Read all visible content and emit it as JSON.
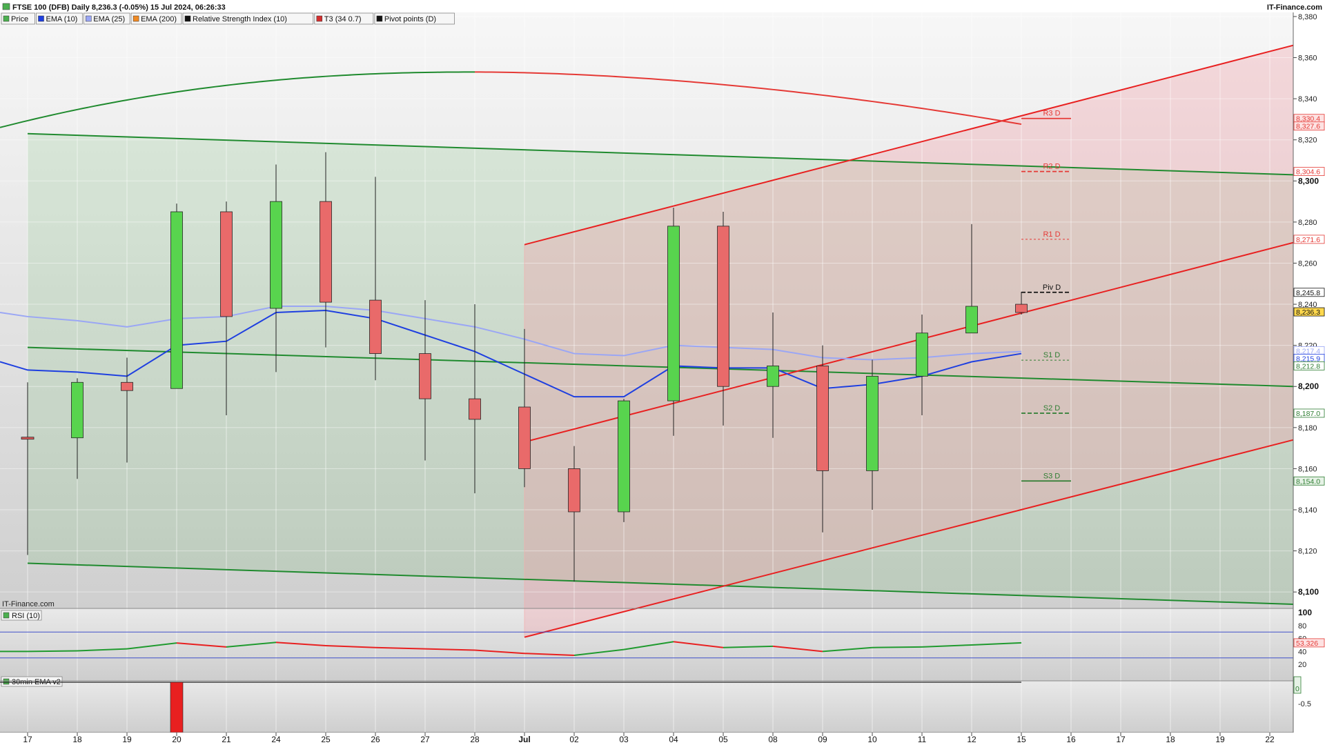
{
  "header": {
    "title": "FTSE 100 (DFB) Daily 8,236.3 (-0.05%) 15 Jul 2024, 06:26:33",
    "brand": "IT-Finance.com",
    "watermark": "IT-Finance.com",
    "legend": [
      {
        "label": "Price",
        "color": "#4caf50"
      },
      {
        "label": "EMA (10)",
        "color": "#1e3fe0"
      },
      {
        "label": "EMA (25)",
        "color": "#9aa6f5"
      },
      {
        "label": "EMA (200)",
        "color": "#f08a24"
      },
      {
        "label": "Relative Strength Index (10)",
        "color": "#111111"
      },
      {
        "label": "T3 (34 0.7)",
        "color": "#d32f2f"
      },
      {
        "label": "Pivot points (D)",
        "color": "#111111"
      }
    ]
  },
  "chart_data": {
    "type": "candlestick",
    "x_labels": [
      "17",
      "18",
      "19",
      "20",
      "21",
      "24",
      "25",
      "26",
      "27",
      "28",
      "Jul",
      "02",
      "03",
      "04",
      "05",
      "08",
      "09",
      "10",
      "11",
      "12",
      "15",
      "16",
      "17",
      "18",
      "19",
      "22"
    ],
    "candles": [
      {
        "o": 8175,
        "h": 8202,
        "l": 8118,
        "c": 8175
      },
      {
        "o": 8175,
        "h": 8204,
        "l": 8155,
        "c": 8202
      },
      {
        "o": 8202,
        "h": 8214,
        "l": 8163,
        "c": 8198
      },
      {
        "o": 8199,
        "h": 8289,
        "l": 8199,
        "c": 8285
      },
      {
        "o": 8285,
        "h": 8290,
        "l": 8186,
        "c": 8234
      },
      {
        "o": 8238,
        "h": 8308,
        "l": 8207,
        "c": 8290
      },
      {
        "o": 8290,
        "h": 8314,
        "l": 8219,
        "c": 8241
      },
      {
        "o": 8242,
        "h": 8302,
        "l": 8203,
        "c": 8216
      },
      {
        "o": 8216,
        "h": 8242,
        "l": 8164,
        "c": 8194
      },
      {
        "o": 8194,
        "h": 8240,
        "l": 8148,
        "c": 8184
      },
      {
        "o": 8190,
        "h": 8228,
        "l": 8151,
        "c": 8160
      },
      {
        "o": 8160,
        "h": 8171,
        "l": 8105,
        "c": 8139
      },
      {
        "o": 8139,
        "h": 8194,
        "l": 8134,
        "c": 8193
      },
      {
        "o": 8193,
        "h": 8287,
        "l": 8176,
        "c": 8278
      },
      {
        "o": 8278,
        "h": 8285,
        "l": 8181,
        "c": 8200
      },
      {
        "o": 8200,
        "h": 8236,
        "l": 8175,
        "c": 8210
      },
      {
        "o": 8210,
        "h": 8220,
        "l": 8129,
        "c": 8159
      },
      {
        "o": 8159,
        "h": 8213,
        "l": 8140,
        "c": 8205
      },
      {
        "o": 8205,
        "h": 8235,
        "l": 8186,
        "c": 8226
      },
      {
        "o": 8226,
        "h": 8279,
        "l": 8226,
        "c": 8239
      },
      {
        "o": 8240,
        "h": 8246,
        "l": 8235,
        "c": 8236
      }
    ],
    "ema10": [
      8208,
      8207,
      8205,
      8220,
      8222,
      8236,
      8237,
      8233,
      8225,
      8217,
      8206,
      8195,
      8195,
      8210,
      8209,
      8209,
      8199,
      8201,
      8205,
      8212,
      8216
    ],
    "ema25": [
      8234,
      8232,
      8229,
      8233,
      8234,
      8239,
      8239,
      8237,
      8233,
      8229,
      8223,
      8216,
      8215,
      8220,
      8219,
      8218,
      8214,
      8213,
      8214,
      8216,
      8217
    ],
    "t3": {
      "color": "#e53935",
      "y_at_x0": 8329,
      "peak": 8353
    },
    "green_channel": {
      "upper": [
        8323,
        8303
      ],
      "middle": [
        8219,
        8200
      ],
      "lower": [
        8114,
        8094
      ]
    },
    "red_channel": {
      "upper": [
        8269,
        8366
      ],
      "middle": [
        8173,
        8270
      ],
      "lower": [
        8078,
        8174
      ]
    },
    "pivots": [
      {
        "label": "R3 D",
        "value": 8330.4,
        "color": "#e53935",
        "style": "solid"
      },
      {
        "label": "R2 D",
        "value": 8304.6,
        "color": "#e53935",
        "style": "dashed"
      },
      {
        "label": "R1 D",
        "value": 8271.6,
        "color": "#e53935",
        "style": "dotted"
      },
      {
        "label": "Piv D",
        "value": 8245.8,
        "color": "#111111",
        "style": "dashed"
      },
      {
        "label": "S1 D",
        "value": 8212.8,
        "color": "#2e7d32",
        "style": "dotted"
      },
      {
        "label": "S2 D",
        "value": 8187.0,
        "color": "#2e7d32",
        "style": "dashed"
      },
      {
        "label": "S3 D",
        "value": 8154.0,
        "color": "#2e7d32",
        "style": "solid"
      }
    ],
    "y_ticks": [
      "8,380",
      "8,360",
      "8,340",
      "8,320",
      "8,300",
      "8,280",
      "8,260",
      "8,240",
      "8,220",
      "8,200",
      "8,180",
      "8,160",
      "8,140",
      "8,120",
      "8,100"
    ],
    "ylim": [
      8092,
      8382
    ],
    "price_tags": [
      {
        "text": "8,330.4",
        "value": 8330.4,
        "color": "#e53935",
        "bg": "#fde2e2"
      },
      {
        "text": "8,327.6",
        "value": 8327.6,
        "color": "#e53935",
        "bg": "#fde2e2"
      },
      {
        "text": "8,304.6",
        "value": 8304.6,
        "color": "#e53935",
        "bg": "#ffffff"
      },
      {
        "text": "8,271.6",
        "value": 8271.6,
        "color": "#e53935",
        "bg": "#ffffff"
      },
      {
        "text": "8,245.8",
        "value": 8245.8,
        "color": "#111111",
        "bg": "#ffffff"
      },
      {
        "text": "8,236.3",
        "value": 8236.3,
        "color": "#111111",
        "bg": "#ffd84d"
      },
      {
        "text": "8,217.4",
        "value": 8217.4,
        "color": "#9aa6f5",
        "bg": "#ffffff"
      },
      {
        "text": "8,215.9",
        "value": 8215.9,
        "color": "#1e3fe0",
        "bg": "#ffffff"
      },
      {
        "text": "8,212.8",
        "value": 8212.8,
        "color": "#2e7d32",
        "bg": "#ffffff"
      },
      {
        "text": "8,187.0",
        "value": 8187.0,
        "color": "#2e7d32",
        "bg": "#ffffff"
      },
      {
        "text": "8,154.0",
        "value": 8154.0,
        "color": "#2e7d32",
        "bg": "#e6f2e6"
      }
    ],
    "rsi": {
      "label": "RSI (10)",
      "values": [
        40,
        41,
        44,
        53,
        47,
        54,
        49,
        46,
        44,
        42,
        37,
        34,
        43,
        55,
        46,
        48,
        40,
        46,
        47,
        50,
        53.3
      ],
      "ticks": [
        "100",
        "80",
        "60",
        "40",
        "20"
      ],
      "upper_band": 70,
      "lower_band": 30,
      "tag": "53.326"
    },
    "ema30": {
      "label": "30min EMA v2",
      "values": [
        0,
        0,
        0,
        -1,
        0,
        0,
        0,
        0,
        0,
        0,
        0,
        0,
        0,
        0,
        0,
        0,
        0,
        0,
        0,
        0,
        0
      ],
      "tick": "-0.5",
      "tag": "0"
    }
  }
}
